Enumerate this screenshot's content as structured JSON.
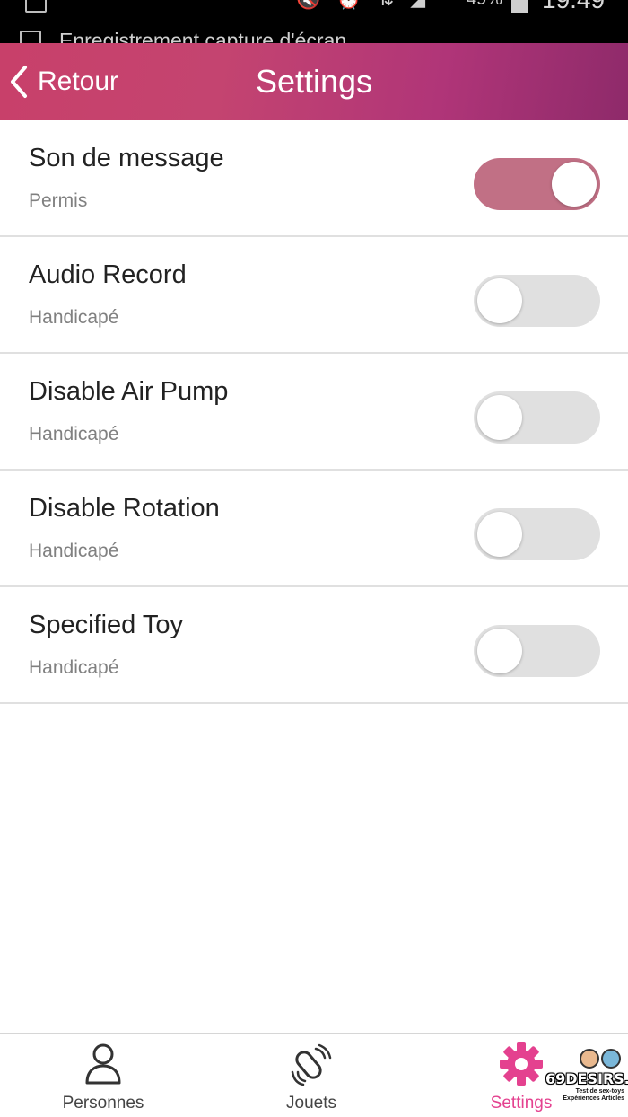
{
  "status_bar": {
    "battery": "49%",
    "time": "19:49",
    "notification": "Enregistrement capture d'écran"
  },
  "header": {
    "back_label": "Retour",
    "title": "Settings"
  },
  "settings": [
    {
      "title": "Son de message",
      "status": "Permis",
      "enabled": true
    },
    {
      "title": "Audio Record",
      "status": "Handicapé",
      "enabled": false
    },
    {
      "title": "Disable Air Pump",
      "status": "Handicapé",
      "enabled": false
    },
    {
      "title": "Disable Rotation",
      "status": "Handicapé",
      "enabled": false
    },
    {
      "title": "Specified Toy",
      "status": "Handicapé",
      "enabled": false
    }
  ],
  "bottom_nav": {
    "items": [
      {
        "label": "Personnes",
        "icon": "person-icon",
        "active": false
      },
      {
        "label": "Jouets",
        "icon": "toy-icon",
        "active": false
      },
      {
        "label": "Settings",
        "icon": "gear-icon",
        "active": true
      }
    ]
  },
  "watermark": {
    "name": "69DESIRS.FR",
    "tagline": "Test de sex-toys Expériences Articles"
  },
  "colors": {
    "accent": "#e4418f",
    "toggle_on": "#c17085",
    "header_start": "#c8406a",
    "header_end": "#8e2a6a"
  }
}
